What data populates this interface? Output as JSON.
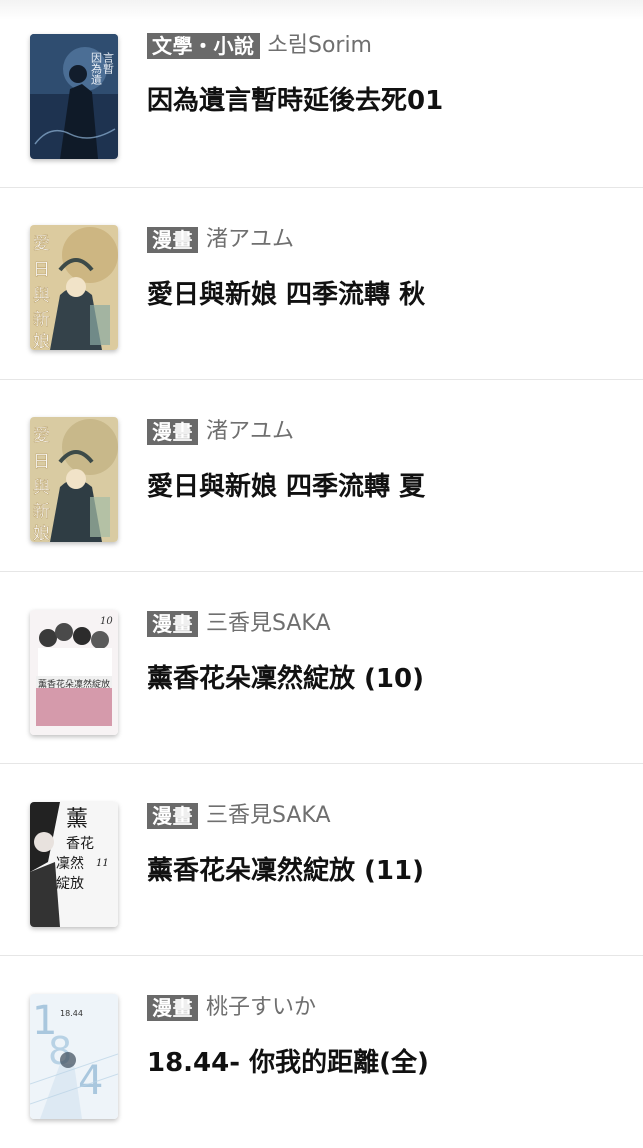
{
  "books": [
    {
      "category": "文學・小說",
      "author": "소림Sorim",
      "title": "因為遺言暫時延後去死01",
      "cover_icon": "book-cover-dark-blue",
      "cover_colors": {
        "bg": "#1f3550",
        "accent": "#6e93b8",
        "text": "#e9eef4"
      },
      "cover_text": "因為遺言暫時延後去死"
    },
    {
      "category": "漫畫",
      "author": "渚アユム",
      "title": "愛日與新娘 四季流轉 秋",
      "cover_icon": "book-cover-tan",
      "cover_colors": {
        "bg": "#d8c79c",
        "accent": "#8aa7a2",
        "text": "#ffffff"
      },
      "cover_text": "愛日與新娘"
    },
    {
      "category": "漫畫",
      "author": "渚アユム",
      "title": "愛日與新娘 四季流轉 夏",
      "cover_icon": "book-cover-tan",
      "cover_colors": {
        "bg": "#d6c79f",
        "accent": "#9db3a5",
        "text": "#ffffff"
      },
      "cover_text": "愛日與新娘"
    },
    {
      "category": "漫畫",
      "author": "三香見SAKA",
      "title": "薰香花朵凜然綻放 (10)",
      "cover_icon": "book-cover-white-pink",
      "cover_colors": {
        "bg": "#f6f2f3",
        "accent": "#c98a9c",
        "text": "#333333"
      },
      "cover_text": "薰香花朵凜然綻放"
    },
    {
      "category": "漫畫",
      "author": "三香見SAKA",
      "title": "薰香花朵凜然綻放 (11)",
      "cover_icon": "book-cover-white-black",
      "cover_colors": {
        "bg": "#f5f5f5",
        "accent": "#222222",
        "text": "#1a1a1a"
      },
      "cover_text": "薰香花朵凜然綻放"
    },
    {
      "category": "漫畫",
      "author": "桃子すいか",
      "title": "18.44- 你我的距離(全)",
      "cover_icon": "book-cover-light-blue",
      "cover_colors": {
        "bg": "#eaf2f8",
        "accent": "#9cc2dd",
        "text": "#7fa8c8"
      },
      "cover_text": "18.44"
    }
  ]
}
